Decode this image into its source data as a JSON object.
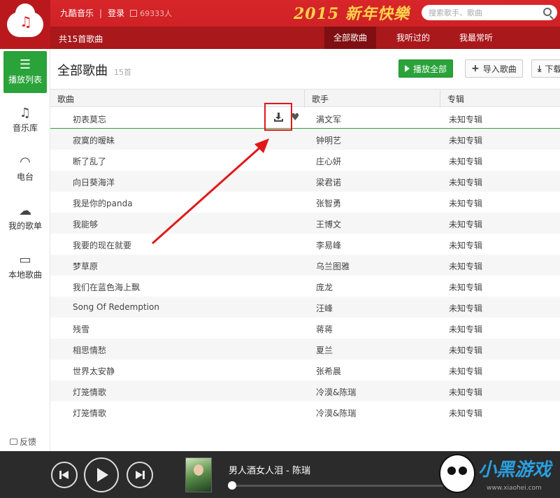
{
  "header": {
    "app_name": "九酷音乐",
    "separator": "|",
    "login": "登录",
    "online_count": "69333人",
    "banner": "2015 新年快樂",
    "search_placeholder": "搜索歌手、歌曲"
  },
  "subbar": {
    "total": "共15首歌曲",
    "tabs": [
      {
        "label": "全部歌曲",
        "active": true
      },
      {
        "label": "我听过的",
        "active": false
      },
      {
        "label": "我最常听",
        "active": false
      }
    ]
  },
  "sidebar": {
    "items": [
      {
        "label": "播放列表",
        "icon": "list-icon",
        "active": true
      },
      {
        "label": "音乐库",
        "icon": "music-note-icon",
        "active": false
      },
      {
        "label": "电台",
        "icon": "wifi-icon",
        "active": false
      },
      {
        "label": "我的歌单",
        "icon": "cloud-icon",
        "active": false
      },
      {
        "label": "本地歌曲",
        "icon": "monitor-icon",
        "active": false
      }
    ],
    "feedback": "反馈"
  },
  "main": {
    "title": "全部歌曲",
    "count": "15首",
    "buttons": {
      "play_all": "播放全部",
      "import": "导入歌曲",
      "download": "下载"
    },
    "columns": {
      "song": "歌曲",
      "artist": "歌手",
      "album": "专辑"
    },
    "rows": [
      {
        "song": "初表莫忘",
        "artist": "满文军",
        "album": "未知专辑"
      },
      {
        "song": "寂寞的暧昧",
        "artist": "钟明艺",
        "album": "未知专辑"
      },
      {
        "song": "断了乱了",
        "artist": "庄心妍",
        "album": "未知专辑"
      },
      {
        "song": "向日葵海洋",
        "artist": "梁君诺",
        "album": "未知专辑"
      },
      {
        "song": "我是你的panda",
        "artist": "张智勇",
        "album": "未知专辑"
      },
      {
        "song": "我能够",
        "artist": "王博文",
        "album": "未知专辑"
      },
      {
        "song": "我要的现在就要",
        "artist": "李易峰",
        "album": "未知专辑"
      },
      {
        "song": "梦草原",
        "artist": "乌兰图雅",
        "album": "未知专辑"
      },
      {
        "song": "我们在蓝色海上飘",
        "artist": "庞龙",
        "album": "未知专辑"
      },
      {
        "song": "Song Of Redemption",
        "artist": "汪峰",
        "album": "未知专辑"
      },
      {
        "song": "残雪",
        "artist": "蒋蒋",
        "album": "未知专辑"
      },
      {
        "song": "相思情愁",
        "artist": "夏兰",
        "album": "未知专辑"
      },
      {
        "song": "世界太安静",
        "artist": "张希晨",
        "album": "未知专辑"
      },
      {
        "song": "灯笼情歌",
        "artist": "冷漠&陈瑞",
        "album": "未知专辑"
      },
      {
        "song": "灯笼情歌",
        "artist": "冷漠&陈瑞",
        "album": "未知专辑"
      }
    ]
  },
  "player": {
    "now_playing": "男人酒女人泪 - 陈瑞",
    "progress": 0.0
  },
  "watermark": {
    "brand": "小黑游戏",
    "url": "www.xiaohei.com"
  },
  "colors": {
    "header_red": "#d8262a",
    "accent_green": "#2aa33a",
    "highlight_red": "#e21818"
  }
}
